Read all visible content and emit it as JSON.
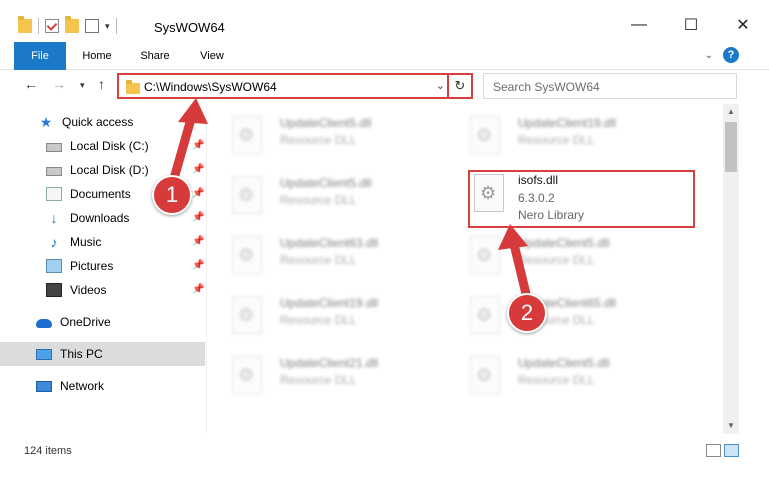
{
  "window": {
    "title": "SysWOW64",
    "minimize": "—",
    "maximize": "☐",
    "close": "✕"
  },
  "ribbon": {
    "tabs": [
      "File",
      "Home",
      "Share",
      "View"
    ]
  },
  "navbar": {
    "path": "C:\\Windows\\SysWOW64",
    "search_placeholder": "Search SysWOW64"
  },
  "sidebar": {
    "items": [
      {
        "label": "Quick access",
        "icon": "star-icon"
      },
      {
        "label": "Local Disk (C:)",
        "icon": "drive-icon",
        "pinned": true
      },
      {
        "label": "Local Disk (D:)",
        "icon": "drive-icon",
        "pinned": true
      },
      {
        "label": "Documents",
        "icon": "documents-icon",
        "pinned": true
      },
      {
        "label": "Downloads",
        "icon": "download-icon",
        "pinned": true
      },
      {
        "label": "Music",
        "icon": "music-icon",
        "pinned": true
      },
      {
        "label": "Pictures",
        "icon": "pictures-icon",
        "pinned": true
      },
      {
        "label": "Videos",
        "icon": "videos-icon",
        "pinned": true
      },
      {
        "label": "OneDrive",
        "icon": "cloud-icon"
      },
      {
        "label": "This PC",
        "icon": "computer-icon",
        "selected": true
      },
      {
        "label": "Network",
        "icon": "network-icon"
      }
    ]
  },
  "files": {
    "left": [
      {
        "name": "UpdateClient5.dll",
        "type": "Resource DLL"
      },
      {
        "name": "UpdateClient5.dll",
        "type": "Resource DLL"
      },
      {
        "name": "UpdateClient63.dll",
        "type": "Resource DLL"
      },
      {
        "name": "UpdateClient19.dll",
        "type": "Resource DLL"
      },
      {
        "name": "UpdateClient21.dll",
        "type": "Resource DLL"
      }
    ],
    "right": [
      {
        "name": "UpdateClient19.dll",
        "type": "Resource DLL"
      },
      {
        "name": "UpdateClient5.dll",
        "type": "Resource DLL"
      },
      {
        "name": "UpdateClient65.dll",
        "type": "Resource DLL"
      },
      {
        "name": "UpdateClient5.dll",
        "type": "Resource DLL"
      }
    ],
    "highlighted": {
      "name": "isofs.dll",
      "version": "6.3.0.2",
      "description": "Nero Library"
    }
  },
  "status": {
    "item_count": "124 items"
  },
  "annotations": {
    "step1": "1",
    "step2": "2",
    "accent_color": "#d63a3a"
  }
}
